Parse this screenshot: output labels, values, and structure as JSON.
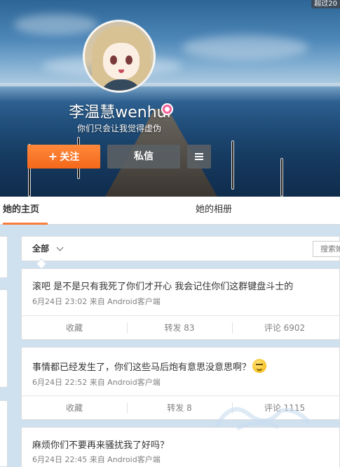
{
  "cover": {
    "corner_tag": "超过20"
  },
  "profile": {
    "name": "李温慧wenhui",
    "bio": "你们只会让我觉得虚伪",
    "follow_label": "关注",
    "message_label": "私信"
  },
  "tabs": {
    "home": "她的主页",
    "album": "她的相册"
  },
  "feed": {
    "filter_label": "全部",
    "search_placeholder": "搜索她"
  },
  "posts": [
    {
      "text": "滚吧 是不是只有我死了你们才开心 我会记住你们这群键盘斗士的",
      "meta": "6月24日 23:02 来自 Android客户端",
      "favorite": "收藏",
      "repost": "转发 83",
      "comment": "评论 6902"
    },
    {
      "text": "事情都已经发生了，你们这些马后炮有意思没意思啊？",
      "meta": "6月24日 22:52 来自 Android客户端",
      "favorite": "收藏",
      "repost": "转发 8",
      "comment": "评论 1115"
    },
    {
      "text": "麻烦你们不要再来骚扰我了好吗？",
      "meta": "6月24日 22:45 来自 Android客户端"
    }
  ],
  "icons": {
    "follow": "plus-icon",
    "menu": "hamburger-menu-icon",
    "badge": "female-badge-icon",
    "dropdown": "chevron-down-icon",
    "emoji": "smiley-face-icon"
  },
  "colors": {
    "follow_button": "#f4681a",
    "tab_active_underline": "#fa7d3c",
    "page_background": "#cfe0ee"
  }
}
